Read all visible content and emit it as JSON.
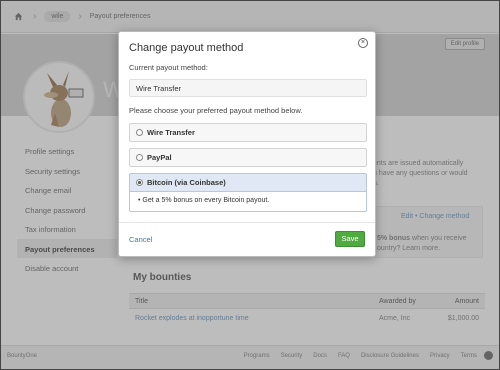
{
  "breadcrumb": {
    "home_icon": "home-icon",
    "items": [
      "wile",
      "Payout preferences"
    ]
  },
  "profile": {
    "name_partial": "W",
    "edit_profile_label": "Edit profile"
  },
  "sidebar": {
    "items": [
      {
        "label": "Profile settings"
      },
      {
        "label": "Security settings"
      },
      {
        "label": "Change email"
      },
      {
        "label": "Change password"
      },
      {
        "label": "Tax information"
      },
      {
        "label": "Payout preferences",
        "active": true
      },
      {
        "label": "Disable account"
      }
    ]
  },
  "background": {
    "right_text_1": "ents are issued automatically",
    "right_text_2": "u have any questions or would",
    "right_text_3": "n.",
    "edit_link": "Edit",
    "separator": "•",
    "change_method_link": "Change method",
    "bonus_text_bold": "5% bonus",
    "bonus_text_rest": "when you receive",
    "bonus_text_2": "ountry? Learn more.",
    "bounties_title": "My bounties",
    "table": {
      "headers": [
        "Title",
        "Awarded by",
        "Amount"
      ],
      "rows": [
        {
          "title": "Rocket explodes at inopportune time",
          "awarded_by": "Acme, Inc",
          "amount": "$1,000.00"
        }
      ]
    }
  },
  "footer": {
    "brand": "BountyOne",
    "links": [
      "Programs",
      "Security",
      "Docs",
      "FAQ",
      "Disclosure Guidelines",
      "Privacy",
      "Terms"
    ],
    "github_icon": "github-icon"
  },
  "modal": {
    "title": "Change payout method",
    "close_icon": "close-circle-icon",
    "current_label": "Current payout method:",
    "current_value": "Wire Transfer",
    "choose_label": "Please choose your preferred payout method below.",
    "options": [
      {
        "label": "Wire Transfer",
        "selected": false
      },
      {
        "label": "PayPal",
        "selected": false
      },
      {
        "label": "Bitcoin (via Coinbase)",
        "selected": true
      }
    ],
    "bonus_note": "• Get a 5% bonus on every Bitcoin payout.",
    "cancel_label": "Cancel",
    "save_label": "Save"
  },
  "colors": {
    "accent_link": "#3a78b8",
    "save_green": "#4faa3f",
    "selected_option_bg": "#dfe8f4",
    "overlay": "rgba(0,0,0,0.26)"
  }
}
